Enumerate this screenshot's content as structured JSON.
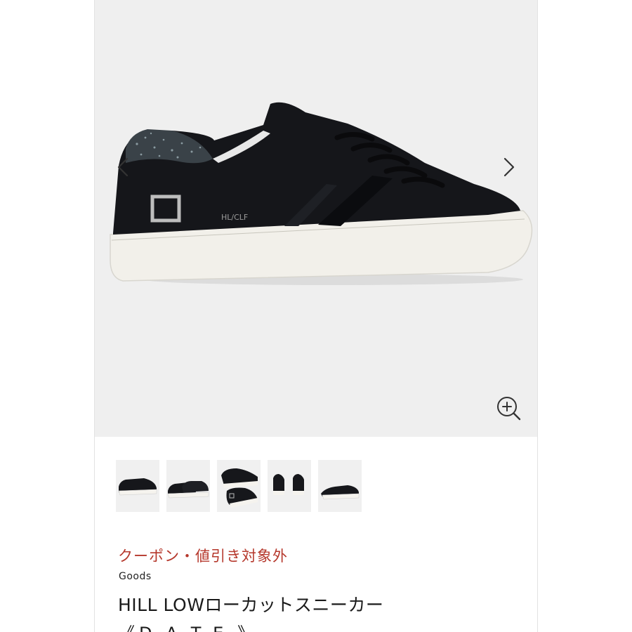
{
  "product_image": {
    "heel_text": "HL/CLF",
    "icons": {
      "prev": "chevron-left-icon",
      "next": "chevron-right-icon",
      "zoom": "zoom-in-icon"
    }
  },
  "thumbnails": [
    {
      "view": "side-left"
    },
    {
      "view": "side-right"
    },
    {
      "view": "top-pair"
    },
    {
      "view": "back-pair"
    },
    {
      "view": "front-angle"
    }
  ],
  "product": {
    "coupon_notice": "クーポン・値引き対象外",
    "category": "Goods",
    "title": "HILL LOWローカットスニーカー",
    "brand": "《D.A.T.E.》"
  },
  "colors": {
    "coupon": "#b5372b",
    "background": "#efefef"
  }
}
